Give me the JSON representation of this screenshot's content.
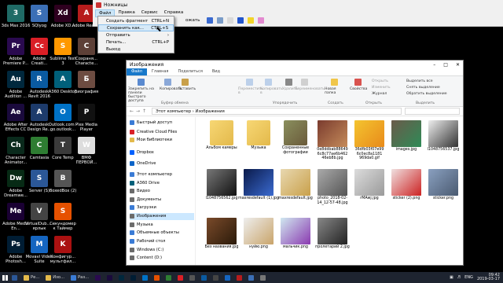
{
  "desktop": {
    "icons": [
      {
        "label": "3ds Max 2016",
        "color": "#1f6b66",
        "glyph": "3"
      },
      {
        "label": "Adobe Premiere P...",
        "color": "#2a0a4f",
        "glyph": "Pr"
      },
      {
        "label": "Adobe Audition ...",
        "color": "#00283d",
        "glyph": "Au"
      },
      {
        "label": "Adobe After Effects CC",
        "color": "#1a0a3c",
        "glyph": "Ae"
      },
      {
        "label": "Character Animator...",
        "color": "#0a2a1c",
        "glyph": "Ch"
      },
      {
        "label": "Adobe Dreamwe...",
        "color": "#072a15",
        "glyph": "Dw"
      },
      {
        "label": "Adobe Media En...",
        "color": "#1a0033",
        "glyph": "Me"
      },
      {
        "label": "Adobe Photosh...",
        "color": "#001d34",
        "glyph": "Ps"
      },
      {
        "label": "SQlyog",
        "color": "#3b6fb6",
        "glyph": "S"
      },
      {
        "label": "Adobe Creati...",
        "color": "#da1f26",
        "glyph": "Cc"
      },
      {
        "label": "Autodesk Revit 2016",
        "color": "#0a5aa0",
        "glyph": "R"
      },
      {
        "label": "Autodesk Design Re...",
        "color": "#1d3b6b",
        "glyph": "A"
      },
      {
        "label": "Camtasia",
        "color": "#2e7d32",
        "glyph": "C"
      },
      {
        "label": "Server (S)",
        "color": "#2b5797",
        "glyph": "S"
      },
      {
        "label": "VirtualDub... - ярлык",
        "color": "#444",
        "glyph": "V"
      },
      {
        "label": "Movavi Video Suite",
        "color": "#1565c0",
        "glyph": "M"
      },
      {
        "label": "Adobe XD...",
        "color": "#2e001f",
        "glyph": "Xd"
      },
      {
        "label": "Sublime Text 3",
        "color": "#ff9800",
        "glyph": "S"
      },
      {
        "label": "A360 Desktop",
        "color": "#00607a",
        "glyph": "A"
      },
      {
        "label": "Outlook.com - go.outlook...",
        "color": "#0072c6",
        "glyph": "O"
      },
      {
        "label": "Core Temp",
        "color": "#3a3a3a",
        "glyph": "T"
      },
      {
        "label": "BoxedBox (2)",
        "color": "#555",
        "glyph": "B"
      },
      {
        "label": "Секундомер к Таймер",
        "color": "#e65100",
        "glyph": "S"
      },
      {
        "label": "Конфигур... мультфил...",
        "color": "#a11",
        "glyph": "K"
      },
      {
        "label": "Adobe Reader",
        "color": "#b71c1c",
        "glyph": "A"
      },
      {
        "label": "Сохраня... Characte...",
        "color": "#5d4037",
        "glyph": "C"
      },
      {
        "label": "Биография",
        "color": "#6d4c41",
        "glyph": "Б"
      },
      {
        "label": "Plex Media Player",
        "color": "#111",
        "glyph": "P"
      },
      {
        "label": "BMФ ПЕРВОЙ...",
        "color": "#ddd",
        "glyph": "W"
      }
    ]
  },
  "snip": {
    "title": "Ножницы",
    "menu": [
      "Файл",
      "Правка",
      "Сервис",
      "Справка"
    ],
    "toolbar_text": "ожать"
  },
  "dropdown": {
    "items": [
      {
        "label": "Создать фрагмент",
        "shortcut": "CTRL+N"
      },
      {
        "label": "Сохранить как...",
        "shortcut": "CTRL+S"
      },
      {
        "label": "Отправить",
        "shortcut": "›"
      },
      {
        "label": "Печать...",
        "shortcut": "CTRL+P"
      },
      {
        "label": "Выход",
        "shortcut": ""
      }
    ]
  },
  "explorer": {
    "title": "Изображения",
    "tabs": [
      "Файл",
      "Главная",
      "Поделиться",
      "Вид"
    ],
    "ribbon": {
      "pin": "Закрепить на панели быстрого доступа",
      "copy": "Копировать",
      "paste": "Вставить",
      "clipboard_group": "Буфер обмена",
      "move_to": "Переместить в",
      "copy_to": "Копировать в",
      "delete": "Удалить",
      "rename": "Переименовать",
      "new_folder": "Новая папка",
      "organize_group": "Упорядочить",
      "create_group": "Создать",
      "properties": "Свойства",
      "open": "Открыть",
      "edit": "Изменить",
      "history": "Журнал",
      "open_group": "Открыть",
      "select_all": "Выделить все",
      "select_none": "Снять выделение",
      "invert": "Обратить выделение",
      "select_group": "Выделить"
    },
    "address": [
      "Этот компьютер",
      "Изображения"
    ],
    "nav": [
      {
        "label": "Быстрый доступ",
        "color": "#3a7bd5"
      },
      {
        "label": "Creative Cloud Files",
        "color": "#da1f26"
      },
      {
        "label": "Мои библиотеки",
        "color": "#e3b94b"
      },
      {
        "label": "Dropbox",
        "color": "#0061fe"
      },
      {
        "label": "OneDrive",
        "color": "#0a64c8"
      },
      {
        "label": "Этот компьютер",
        "color": "#3a7bd5"
      },
      {
        "label": "A360 Drive",
        "color": "#00607a"
      },
      {
        "label": "Видео",
        "color": "#6b6b6b"
      },
      {
        "label": "Документы",
        "color": "#6b6b6b"
      },
      {
        "label": "Загрузки",
        "color": "#3a7bd5"
      },
      {
        "label": "Изображения",
        "color": "#6b6b6b"
      },
      {
        "label": "Музыка",
        "color": "#6b6b6b"
      },
      {
        "label": "Объемные объекты",
        "color": "#3a7bd5"
      },
      {
        "label": "Рабочий стол",
        "color": "#3a7bd5"
      },
      {
        "label": "Windows (C:)",
        "color": "#6b6b6b"
      },
      {
        "label": "Content (D:)",
        "color": "#6b6b6b"
      }
    ],
    "files": [
      {
        "name": "Альбом камеры",
        "kind": "folder",
        "c1": "#f7d774",
        "c2": "#e3b94b"
      },
      {
        "name": "Музыка",
        "kind": "folder",
        "c1": "#f7d774",
        "c2": "#e3b94b"
      },
      {
        "name": "Сохраненные фотографии",
        "kind": "folder",
        "c1": "#8a8f5e",
        "c2": "#6a5a3a"
      },
      {
        "name": "0e8ddbab88649 6c8c77ae6b462 46eb8b.jpg",
        "kind": "img",
        "c1": "#7a3b2e",
        "c2": "#c58b5a"
      },
      {
        "name": "36dfb03f07e99 6c0ec8a1181 969da0.gif",
        "kind": "img",
        "c1": "#f4c430",
        "c2": "#e88a1a"
      },
      {
        "name": "images.jpg",
        "kind": "img",
        "c1": "#6b5a4a",
        "c2": "#2e8b57"
      },
      {
        "name": "l1048756537.jpg",
        "kind": "img",
        "c1": "#eee",
        "c2": "#333"
      },
      {
        "name": "l1048756562.jpg",
        "kind": "img",
        "c1": "#777",
        "c2": "#111"
      },
      {
        "name": "maxresdefault (1).jpg",
        "kind": "img",
        "c1": "#0a1a4a",
        "c2": "#3a6ad0"
      },
      {
        "name": "maxresdefault.jpg",
        "kind": "img",
        "c1": "#e8d8b0",
        "c2": "#c9a04a"
      },
      {
        "name": "photo_2018-02-14_12-57-48.jpg",
        "kind": "img",
        "c1": "#aaa",
        "c2": "#555"
      },
      {
        "name": "rMAwj.jpg",
        "kind": "img",
        "c1": "#dcdcdc",
        "c2": "#9a9a9a"
      },
      {
        "name": "sticker (2).png",
        "kind": "img",
        "c1": "#f0e0e0",
        "c2": "#c22"
      },
      {
        "name": "sticker.png",
        "kind": "img",
        "c1": "#8aa0c0",
        "c2": "#4a5a70"
      },
      {
        "name": "Без названия.jpg",
        "kind": "img",
        "c1": "#7a4a2a",
        "c2": "#2a1a0a"
      },
      {
        "name": "нуйю.png",
        "kind": "img",
        "c1": "#eee",
        "c2": "#c9a46a"
      },
      {
        "name": "мальчик.png",
        "kind": "img",
        "c1": "#d0e8f0",
        "c2": "#8a3ab0"
      },
      {
        "name": "пролетарий 2.jpg",
        "kind": "img",
        "c1": "#888",
        "c2": "#222"
      }
    ]
  },
  "taskbar": {
    "apps": [
      {
        "label": "",
        "color": "#2b5797"
      },
      {
        "label": "Ре...",
        "color": "#e3b94b"
      },
      {
        "label": "Изо...",
        "color": "#e3b94b"
      },
      {
        "label": "Раз...",
        "color": "#3a7bd5"
      },
      {
        "label": "",
        "color": "#2a0a4f"
      },
      {
        "label": "",
        "color": "#1a0a3c"
      },
      {
        "label": "",
        "color": "#00283d"
      },
      {
        "label": "",
        "color": "#001d34"
      },
      {
        "label": "",
        "color": "#0072c6"
      },
      {
        "label": "",
        "color": "#e65100"
      },
      {
        "label": "",
        "color": "#2e7d32"
      },
      {
        "label": "",
        "color": "#da1f26"
      },
      {
        "label": "",
        "color": "#555"
      },
      {
        "label": "",
        "color": "#0a5aa0"
      },
      {
        "label": "",
        "color": "#444"
      },
      {
        "label": "",
        "color": "#1565c0"
      },
      {
        "label": "",
        "color": "#b71c1c"
      },
      {
        "label": "",
        "color": "#3b6fb6"
      },
      {
        "label": "",
        "color": "#777"
      }
    ],
    "lang": "ENG",
    "time": "09:42",
    "date": "2019-03-17"
  }
}
